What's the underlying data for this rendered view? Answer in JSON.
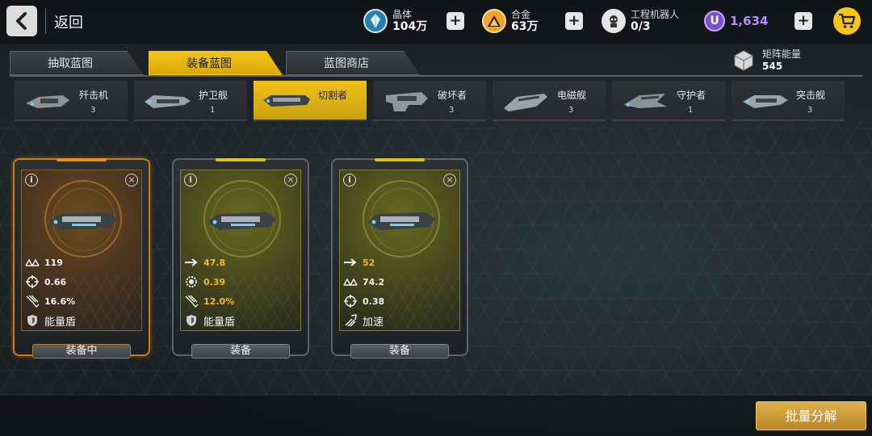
{
  "header": {
    "back_label": "返回",
    "resources": [
      {
        "name": "晶体",
        "value": "104万",
        "icon": "crystal-icon"
      },
      {
        "name": "合金",
        "value": "63万",
        "icon": "alloy-icon"
      },
      {
        "name": "工程机器人",
        "value": "0/3",
        "icon": "robot-icon"
      }
    ],
    "currency": {
      "symbol": "U",
      "value": "1,634",
      "color": "#b48cff"
    },
    "plus_label": "+"
  },
  "tabs": [
    {
      "label": "抽取蓝图",
      "active": false
    },
    {
      "label": "装备蓝图",
      "active": true
    },
    {
      "label": "蓝图商店",
      "active": false
    }
  ],
  "matrix_energy": {
    "name": "矩阵能量",
    "value": "545"
  },
  "ships": [
    {
      "name": "歼击机",
      "count": "3",
      "active": false
    },
    {
      "name": "护卫舰",
      "count": "1",
      "active": false
    },
    {
      "name": "切割者",
      "count": "",
      "active": true
    },
    {
      "name": "破坏者",
      "count": "3",
      "active": false
    },
    {
      "name": "电磁舰",
      "count": "3",
      "active": false
    },
    {
      "name": "守护者",
      "count": "1",
      "active": false
    },
    {
      "name": "突击舰",
      "count": "3",
      "active": false
    }
  ],
  "cards": [
    {
      "theme": "orange",
      "equipped": true,
      "stats": [
        {
          "icon": "armor-icon",
          "value": "119",
          "highlight": false
        },
        {
          "icon": "crosshair-icon",
          "value": "0.66",
          "highlight": false
        },
        {
          "icon": "damage-icon",
          "value": "16.6%",
          "highlight": false
        }
      ],
      "ability": {
        "icon": "shield-icon",
        "label": "能量盾"
      },
      "button_label": "装备中"
    },
    {
      "theme": "yellow",
      "equipped": false,
      "stats": [
        {
          "icon": "speed-arrow-icon",
          "value": "47.8",
          "highlight": true
        },
        {
          "icon": "gear-target-icon",
          "value": "0.39",
          "highlight": true
        },
        {
          "icon": "damage-icon",
          "value": "12.0%",
          "highlight": true
        }
      ],
      "ability": {
        "icon": "shield-icon",
        "label": "能量盾"
      },
      "button_label": "装备"
    },
    {
      "theme": "yellow",
      "equipped": false,
      "stats": [
        {
          "icon": "speed-arrow-icon",
          "value": "52",
          "highlight": true
        },
        {
          "icon": "armor-icon",
          "value": "74.2",
          "highlight": false
        },
        {
          "icon": "crosshair-icon",
          "value": "0.38",
          "highlight": false
        }
      ],
      "ability": {
        "icon": "boost-icon",
        "label": "加速"
      },
      "button_label": "装备"
    }
  ],
  "footer": {
    "dismantle_label": "批量分解"
  }
}
